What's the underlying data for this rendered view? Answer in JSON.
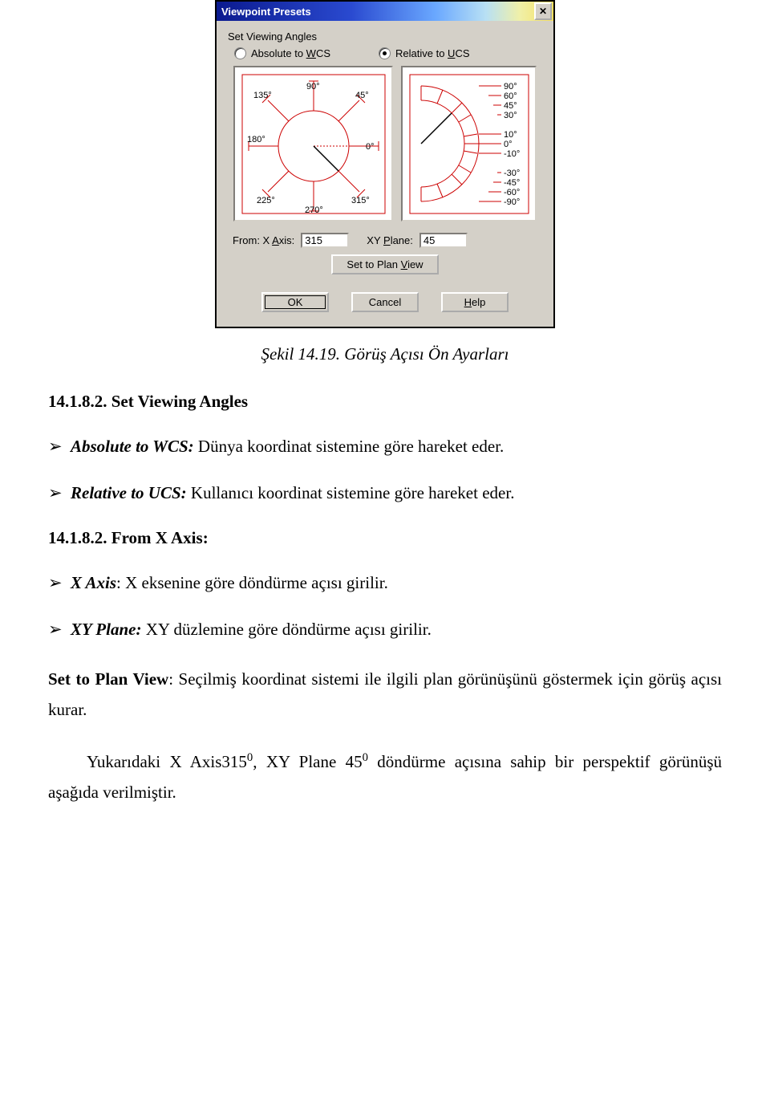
{
  "dialog": {
    "title": "Viewpoint Presets",
    "close": "✕",
    "section_label": "Set Viewing Angles",
    "radio": {
      "absolute_pre": "Absolute to ",
      "absolute_u": "W",
      "absolute_post": "CS",
      "relative_pre": "Relative to ",
      "relative_u": "U",
      "relative_post": "CS"
    },
    "compass": {
      "ticks": [
        "0°",
        "45°",
        "90°",
        "135°",
        "180°",
        "225°",
        "270°",
        "315°"
      ]
    },
    "arc": {
      "ticks": [
        "90°",
        "60°",
        "45°",
        "30°",
        "10°",
        "0°",
        "-10°",
        "-30°",
        "-45°",
        "-60°",
        "-90°"
      ]
    },
    "xaxis_label_pre": "From: X ",
    "xaxis_label_u": "A",
    "xaxis_label_post": "xis:",
    "xaxis_value": "315",
    "xyplane_label_pre": "XY ",
    "xyplane_label_u": "P",
    "xyplane_label_post": "lane:",
    "xyplane_value": "45",
    "plan_btn_pre": "Set to Plan ",
    "plan_btn_u": "V",
    "plan_btn_post": "iew",
    "ok": "OK",
    "cancel": "Cancel",
    "help_u": "H",
    "help_post": "elp"
  },
  "doc": {
    "caption": "Şekil 14.19. Görüş Açısı Ön Ayarları",
    "h1": "14.1.8.2. Set Viewing Angles",
    "bul1_term": "Absolute to WCS:",
    "bul1_txt": " Dünya koordinat sistemine göre hareket eder.",
    "bul2_term": "Relative to UCS:",
    "bul2_txt": " Kullanıcı koordinat sistemine göre hareket eder.",
    "h2": "14.1.8.2. From X Axis:",
    "bul3_term": "X Axis",
    "bul3_txt": ": X eksenine göre döndürme açısı girilir.",
    "bul4_term": "XY Plane:",
    "bul4_txt": " XY düzlemine göre döndürme açısı girilir.",
    "para1_bold": "Set to Plan View",
    "para1_rest": ": Seçilmiş koordinat sistemi ile ilgili plan görünüşünü göstermek için görüş açısı  kurar.",
    "para2_a": "Yukarıdaki X Axis315",
    "para2_b": ", XY Plane 45",
    "para2_c": " döndürme açısına sahip bir perspektif görünüşü aşağıda verilmiştir.",
    "sup": "0"
  }
}
